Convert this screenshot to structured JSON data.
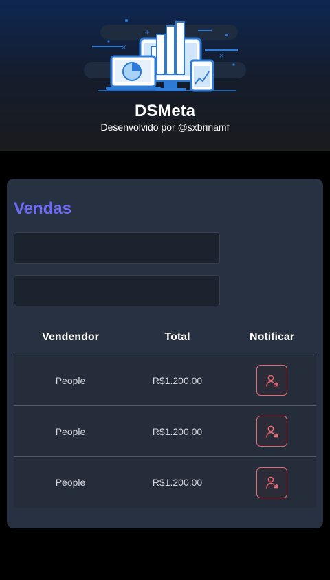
{
  "header": {
    "logo_icon": "dashboard-devices-illustration",
    "title": "DSMeta",
    "subtitle": "Desenvolvido por @sxbrinamf"
  },
  "sales_card": {
    "title": "Vendas",
    "date_inputs": [
      {
        "value": "",
        "placeholder": ""
      },
      {
        "value": "",
        "placeholder": ""
      }
    ],
    "table": {
      "headers": [
        "Vendendor",
        "Total",
        "Notificar"
      ],
      "rows": [
        {
          "seller": "People",
          "total": "R$1.200.00",
          "notify_icon": "notify-user-icon"
        },
        {
          "seller": "People",
          "total": "R$1.200.00",
          "notify_icon": "notify-user-icon"
        },
        {
          "seller": "People",
          "total": "R$1.200.00",
          "notify_icon": "notify-user-icon"
        }
      ]
    }
  },
  "colors": {
    "accent": "#6d6bf5",
    "notify": "#e5676f",
    "card_bg": "#283142",
    "input_bg": "#1b232e",
    "page_bg": "#000000"
  }
}
